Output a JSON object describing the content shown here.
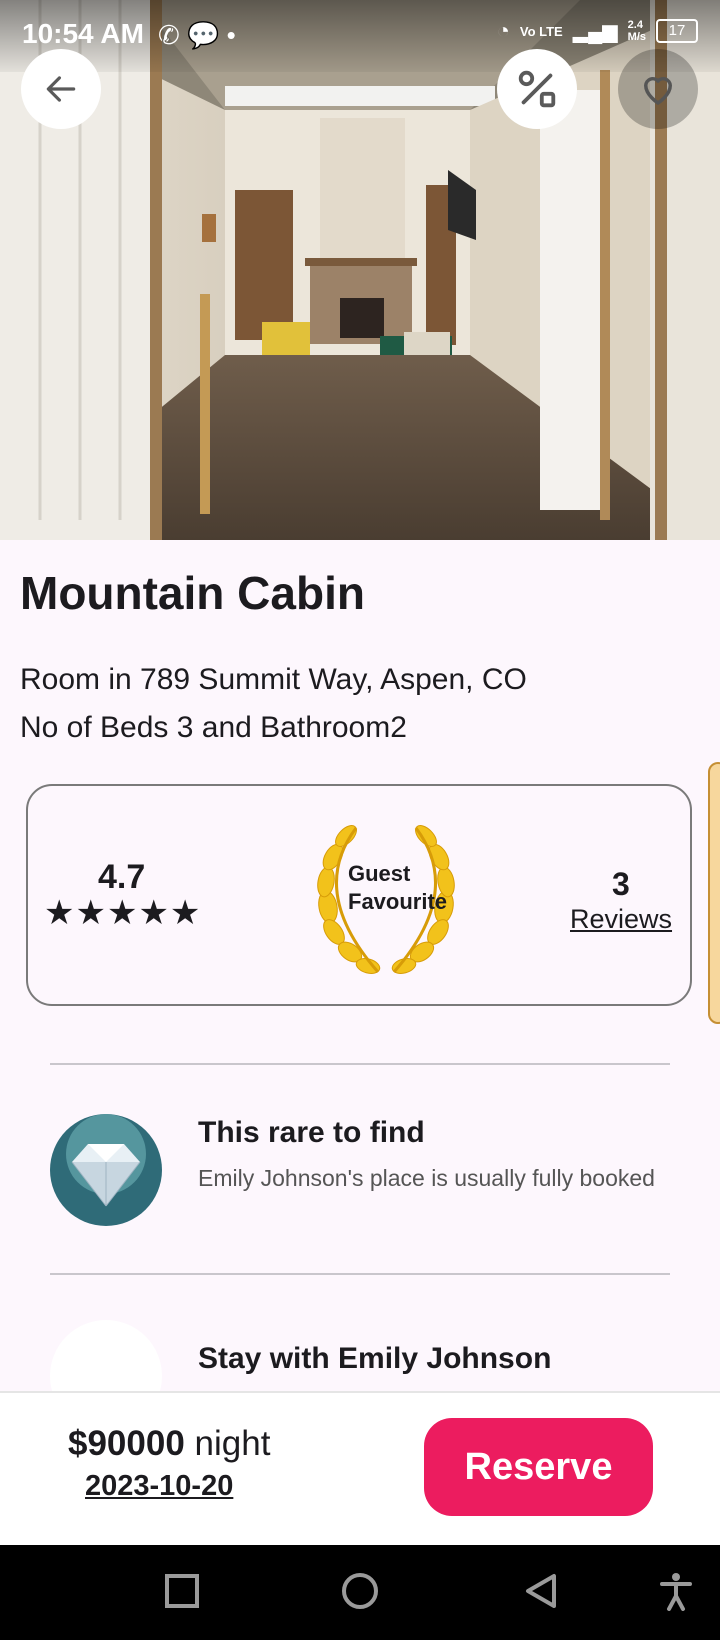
{
  "status_bar": {
    "time": "10:54 AM",
    "net_speed": "2.4",
    "net_unit": "M/s",
    "battery": "17",
    "volte": "Vo LTE"
  },
  "listing": {
    "title": "Mountain Cabin",
    "address": "Room in 789 Summit Way, Aspen, CO",
    "beds": "No of Beds 3 and Bathroom2"
  },
  "rating_card": {
    "rating": "4.7",
    "stars": "★★★★★",
    "badge_line1": "Guest",
    "badge_line2": "Favourite",
    "reviews_count": "3",
    "reviews_label": "Reviews"
  },
  "features": [
    {
      "title": "This rare to find",
      "description": "Emily Johnson's place is usually fully booked"
    },
    {
      "title": "Stay with Emily Johnson"
    }
  ],
  "booking": {
    "price": "$90000",
    "unit": "night",
    "date": "2023-10-20",
    "reserve_label": "Reserve"
  },
  "colors": {
    "accent": "#ec1c5f",
    "background": "#fdf7fd",
    "laurel": "#f2c21b"
  },
  "icons": {
    "back": "arrow-left-icon",
    "share": "percent-share-icon",
    "favorite": "heart-icon"
  }
}
